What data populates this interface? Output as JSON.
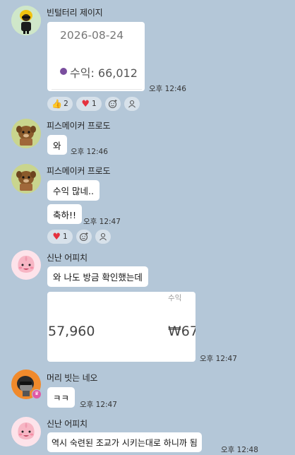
{
  "messages": {
    "m1": {
      "sender": "빈털터리 제이지",
      "card_date": "2026-08-24",
      "card_income": "수익: 66,012",
      "time": "오후 12:46",
      "reactions": {
        "thumbs_count": "2",
        "heart_count": "1"
      }
    },
    "m2": {
      "sender": "피스메이커 프로도",
      "text": "와",
      "time": "오후 12:46"
    },
    "m3": {
      "sender": "피스메이커 프로도",
      "text1": "수익 많네..",
      "text2": "축하!!",
      "time": "오후 12:47",
      "reactions": {
        "heart_count": "1"
      }
    },
    "m4": {
      "sender": "신난 어피치",
      "text": "와 나도 방금 확인했는데",
      "card_label": "수익",
      "card_left_value": "57,960",
      "card_right_value": "₩67",
      "time": "오후 12:47"
    },
    "m5": {
      "sender": "머리 빗는 네오",
      "text": "ㅋㅋ",
      "time": "오후 12:47"
    },
    "m6": {
      "sender": "신난 어피치",
      "text": "역시 숙련된 조교가 시키는대로 하니까 됨",
      "time": "오후 12:48"
    }
  },
  "icons": {
    "thumbs": "thumbs-up-icon",
    "heart": "heart-icon",
    "add_reaction": "add-reaction-icon",
    "profile": "profile-icon"
  },
  "colors": {
    "background": "#b4c7d8",
    "bubble": "#ffffff",
    "heart": "#e5323f",
    "income_dot": "#7a4e9e"
  }
}
